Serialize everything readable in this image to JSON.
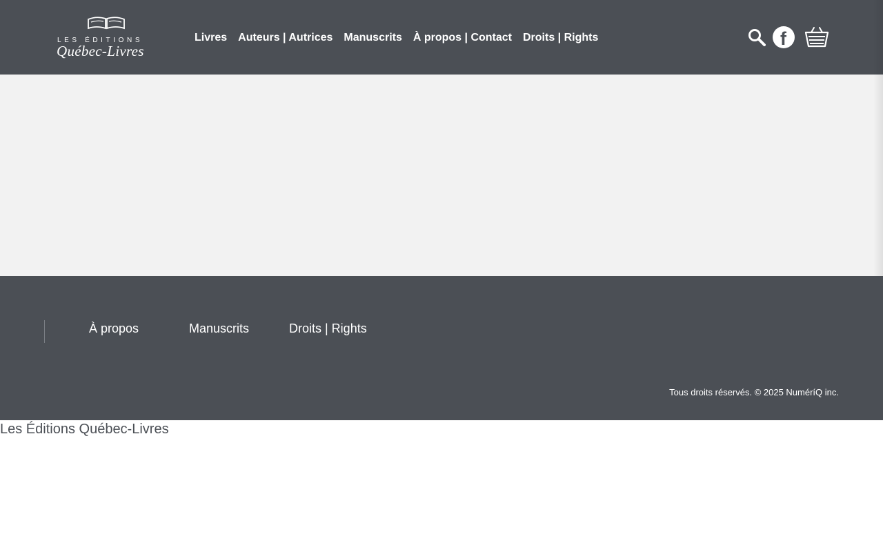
{
  "logo": {
    "line1": "LES ÉDITIONS",
    "line2": "Québec-Livres"
  },
  "nav": {
    "items": [
      {
        "label": "Livres"
      },
      {
        "label": "Auteurs | Autrices"
      },
      {
        "label": "Manuscrits"
      },
      {
        "label": "À propos | Contact"
      },
      {
        "label": "Droits | Rights"
      }
    ]
  },
  "icons": {
    "search": "search-icon",
    "facebook": "facebook-icon",
    "cart": "cart-icon"
  },
  "footer": {
    "links": [
      {
        "label": "À propos"
      },
      {
        "label": "Manuscrits"
      },
      {
        "label": "Droits | Rights"
      }
    ],
    "copyright": "Tous droits réservés. © 2025 NuméríQ inc."
  },
  "site_name": "Les Éditions Québec-Livres",
  "colors": {
    "header_bg": "#4b4f55",
    "hero_bg": "#f2f2f2",
    "text_light": "#ffffff"
  }
}
